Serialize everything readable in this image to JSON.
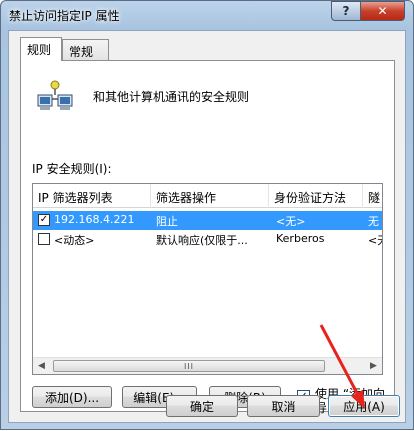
{
  "window": {
    "title": "禁止访问指定IP 属性",
    "help_label": "?",
    "close_label": "✕"
  },
  "tabs": [
    {
      "label": "规则"
    },
    {
      "label": "常规"
    }
  ],
  "header": {
    "text": "和其他计算机通讯的安全规则",
    "icon": "network-computers-icon"
  },
  "rules_label": "IP 安全规则(I):",
  "columns": [
    "IP 筛选器列表",
    "筛选器操作",
    "身份验证方法",
    "隧"
  ],
  "rows": [
    {
      "checked": true,
      "filter": "192.168.4.221",
      "action": "阻止",
      "auth": "<无>",
      "tunnel": "无",
      "selected": true
    },
    {
      "checked": false,
      "filter": "<动态>",
      "action": "默认响应(仅限于...",
      "auth": "Kerberos",
      "tunnel": "<无",
      "selected": false
    }
  ],
  "scrollbar": {
    "left": "◀",
    "right": "▶",
    "grip": "III"
  },
  "buttons": {
    "add": "添加(D)...",
    "edit": "编辑(E)...",
    "remove": "删除(R)"
  },
  "wizard": {
    "checked": true,
    "label": "使用 “添加向导” (W)"
  },
  "footer": {
    "ok": "确定",
    "cancel": "取消",
    "apply": "应用(A)"
  },
  "colors": {
    "selection": "#3399ff",
    "annotation_arrow": "#e8231c"
  }
}
